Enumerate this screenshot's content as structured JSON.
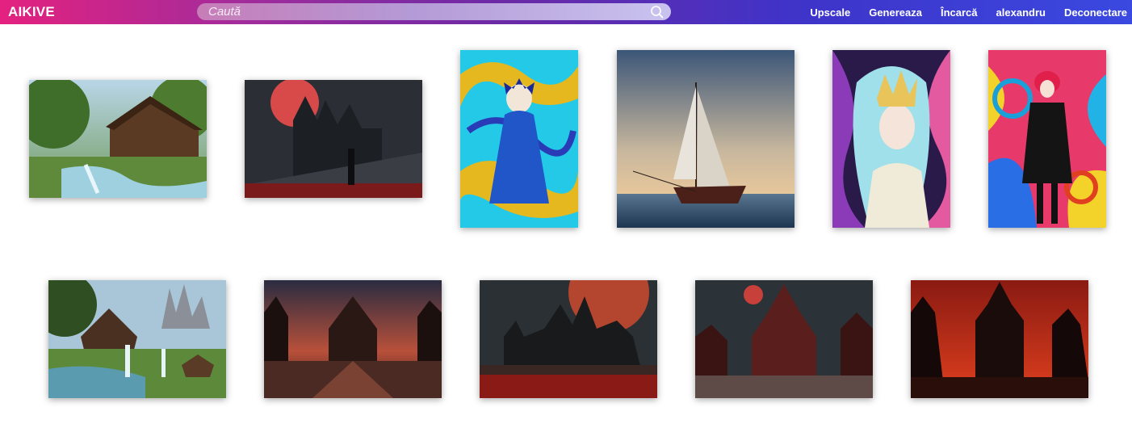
{
  "header": {
    "logo": "AIKIVE",
    "search_placeholder": "Caută",
    "nav": [
      "Upscale",
      "Genereaza",
      "Încarcă",
      "alexandru",
      "Deconectare"
    ]
  },
  "gallery": {
    "row1": [
      "forest-cabin-waterfall",
      "blood-moon-castle",
      "swirl-anime-cat-girl",
      "sailboat-sunset",
      "crowned-goddess-portrait",
      "psychedelic-red-hair-girl"
    ],
    "row2": [
      "valley-cottage-castle",
      "gothic-cathedral-dusk",
      "red-moon-castle-field",
      "crimson-cathedral-plaza",
      "red-sky-gothic-palace"
    ]
  }
}
